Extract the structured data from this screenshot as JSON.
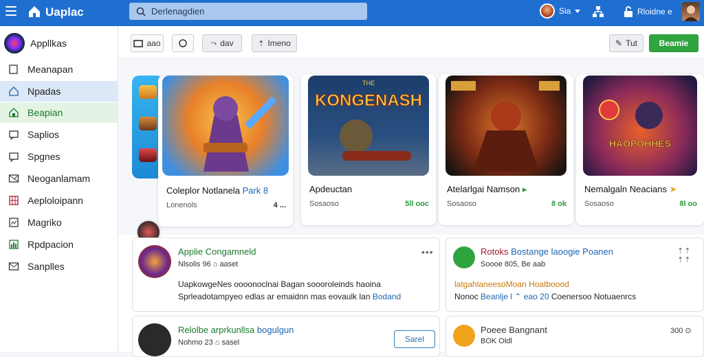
{
  "app": {
    "title": "Uaplac"
  },
  "search": {
    "placeholder": "Derlenagdien"
  },
  "topbar": {
    "user_name": "Sia",
    "alerts_label": "Rloidne e"
  },
  "sidebar": {
    "header": "Appllkas",
    "items": [
      {
        "label": "Meanapan",
        "icon": "monitor-icon"
      },
      {
        "label": "Npadas",
        "icon": "home-icon"
      },
      {
        "label": "Beapian",
        "icon": "home-icon"
      },
      {
        "label": "Saplios",
        "icon": "chat-icon"
      },
      {
        "label": "Spgnes",
        "icon": "chat-icon"
      },
      {
        "label": "Neoganlamam",
        "icon": "mail-icon"
      },
      {
        "label": "Aeploloipann",
        "icon": "calendar-icon"
      },
      {
        "label": "Magriko",
        "icon": "image-icon"
      },
      {
        "label": "Rpdpacion",
        "icon": "chart-icon"
      },
      {
        "label": "Sanplles",
        "icon": "mail-icon"
      }
    ]
  },
  "toolbar": {
    "btn1": "aao",
    "btn3": "dav",
    "btn4": "Imeno",
    "btn5": "Tut",
    "btn6": "Beamie"
  },
  "games": [
    {
      "title": "Coleplor Notlanela",
      "title_extra": "Park 8",
      "sub": "Lonenols",
      "count": "4",
      "count_extra": "..."
    },
    {
      "title": "Apdeuctan",
      "sub": "Sosaoso",
      "count": "5ll ooc",
      "art_text": "KONGENASH",
      "art_top": "THE"
    },
    {
      "title": "Atelarlgai Namson",
      "sub": "Sosaoso",
      "count": "8 ok",
      "art_text": "",
      "art_top": ""
    },
    {
      "title": "Nemalgaln Neacians",
      "sub": "Sosaoso",
      "count": "8l oo",
      "art_text": "HAOPOHHES",
      "art_top": ""
    }
  ],
  "posts": [
    {
      "title": "Applie Congamneld",
      "meta": "Nlsolis 96 ⌂ aaset",
      "line1": "UapkowgeNes oooonoclnai  Bagan soooroleinds haoina",
      "line2": "Sprleadotampyeo edlas ar emaidnn mas eovaulk lan",
      "line2_link": "Bodand"
    },
    {
      "title": "Rotoks",
      "title_link": "Bostange laoogie Poanen",
      "meta": "Soooe 805, Be aab",
      "line1": "latgahlaneesoMoan Hoatboood",
      "line2": "Nonoc",
      "line2_link": "Beanlje l ⌃ eao 20",
      "line2_tail": "Coenersoo  Notuaenrcs",
      "right_meta": "⇡⇡ ⇡⇡"
    },
    {
      "title": "Relolbe arprkunllsa",
      "title_link": "bogulgun",
      "meta": "Nohmo 23 ⌂ sasel",
      "button": "Sarel"
    },
    {
      "title": "Poeee Bangnant",
      "meta": "BOK Oldl",
      "right_meta": "300 ⊙"
    }
  ],
  "colors": {
    "topbar": "#1f6fd1",
    "accent_green": "#2fa43f",
    "link_blue": "#1f64b3"
  }
}
